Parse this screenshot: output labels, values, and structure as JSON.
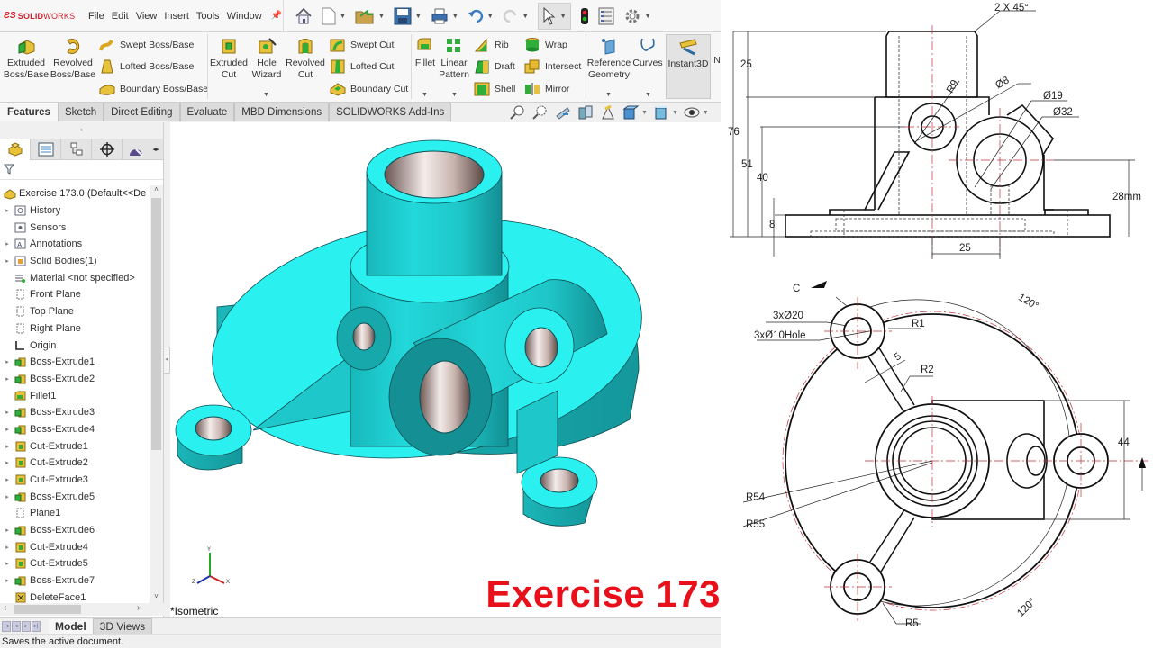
{
  "app": {
    "logo": {
      "prefix": "3DS",
      "brand_bold": "SOLID",
      "brand_light": "WORKS"
    },
    "menu": [
      "File",
      "Edit",
      "View",
      "Insert",
      "Tools",
      "Window"
    ],
    "quick_access_icons": [
      "home-icon",
      "new-document-icon",
      "open-icon",
      "save-icon",
      "print-icon",
      "undo-icon",
      "redo-icon",
      "select-icon",
      "rebuild-icon",
      "file-properties-icon",
      "options-icon"
    ]
  },
  "ribbon": {
    "extruded_boss": "Extruded\nBoss/Base",
    "revolved_boss": "Revolved\nBoss/Base",
    "swept_boss": "Swept Boss/Base",
    "lofted_boss": "Lofted Boss/Base",
    "boundary_boss": "Boundary Boss/Base",
    "extruded_cut": "Extruded\nCut",
    "hole_wizard": "Hole\nWizard",
    "revolved_cut": "Revolved\nCut",
    "swept_cut": "Swept Cut",
    "lofted_cut": "Lofted Cut",
    "boundary_cut": "Boundary Cut",
    "fillet": "Fillet",
    "linear_pattern": "Linear\nPattern",
    "rib": "Rib",
    "draft": "Draft",
    "shell": "Shell",
    "wrap": "Wrap",
    "intersect": "Intersect",
    "mirror": "Mirror",
    "reference_geometry": "Reference\nGeometry",
    "curves": "Curves",
    "instant3d": "Instant3D",
    "overflow": "N"
  },
  "tabs": [
    "Features",
    "Sketch",
    "Direct Editing",
    "Evaluate",
    "MBD Dimensions",
    "SOLIDWORKS Add-Ins"
  ],
  "active_tab": "Features",
  "feature_manager": {
    "root": "Exercise 173.0  (Default<<De",
    "items": [
      {
        "label": "History",
        "expandable": true,
        "icon": "history"
      },
      {
        "label": "Sensors",
        "expandable": false,
        "icon": "sensors"
      },
      {
        "label": "Annotations",
        "expandable": true,
        "icon": "annotations"
      },
      {
        "label": "Solid Bodies(1)",
        "expandable": true,
        "icon": "solid-bodies"
      },
      {
        "label": "Material <not specified>",
        "expandable": false,
        "icon": "material"
      },
      {
        "label": "Front Plane",
        "expandable": false,
        "icon": "plane"
      },
      {
        "label": "Top Plane",
        "expandable": false,
        "icon": "plane"
      },
      {
        "label": "Right Plane",
        "expandable": false,
        "icon": "plane"
      },
      {
        "label": "Origin",
        "expandable": false,
        "icon": "origin"
      },
      {
        "label": "Boss-Extrude1",
        "expandable": true,
        "icon": "boss"
      },
      {
        "label": "Boss-Extrude2",
        "expandable": true,
        "icon": "boss"
      },
      {
        "label": "Fillet1",
        "expandable": false,
        "icon": "fillet"
      },
      {
        "label": "Boss-Extrude3",
        "expandable": true,
        "icon": "boss"
      },
      {
        "label": "Boss-Extrude4",
        "expandable": true,
        "icon": "boss"
      },
      {
        "label": "Cut-Extrude1",
        "expandable": true,
        "icon": "cut"
      },
      {
        "label": "Cut-Extrude2",
        "expandable": true,
        "icon": "cut"
      },
      {
        "label": "Cut-Extrude3",
        "expandable": true,
        "icon": "cut"
      },
      {
        "label": "Boss-Extrude5",
        "expandable": true,
        "icon": "boss"
      },
      {
        "label": "Plane1",
        "expandable": false,
        "icon": "plane"
      },
      {
        "label": "Boss-Extrude6",
        "expandable": true,
        "icon": "boss"
      },
      {
        "label": "Cut-Extrude4",
        "expandable": true,
        "icon": "cut"
      },
      {
        "label": "Cut-Extrude5",
        "expandable": true,
        "icon": "cut"
      },
      {
        "label": "Boss-Extrude7",
        "expandable": true,
        "icon": "boss"
      },
      {
        "label": "DeleteFace1",
        "expandable": false,
        "icon": "deleteface"
      }
    ]
  },
  "bottom_tabs": [
    "Model",
    "3D Views"
  ],
  "status_text": "Saves the active document.",
  "viewport": {
    "view_name": "*Isometric",
    "overlay_title": "Exercise 173",
    "model_color": "#1fe3e3",
    "title_color": "#e8101a",
    "triad_labels": {
      "x": "X",
      "y": "Y",
      "z": "Z"
    }
  },
  "drawing": {
    "front_view": {
      "chamfer": "2 X 45°",
      "dims": [
        "25",
        "76",
        "51",
        "40",
        "8",
        "25",
        "28mm"
      ],
      "labels": {
        "r9": "R9",
        "d8": "Ø8",
        "d19": "Ø19",
        "d32": "Ø32"
      }
    },
    "top_view": {
      "section_marker": "C",
      "labels": {
        "d20": "3xØ20",
        "d10hole": "3xØ10Hole",
        "r1": "R1",
        "w5": "5",
        "r2": "R2",
        "r54": "R54",
        "r55": "R55",
        "r5": "R5",
        "a1": "120°",
        "a2": "120°",
        "h44": "44"
      }
    }
  }
}
